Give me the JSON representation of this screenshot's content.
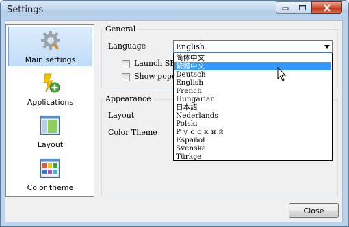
{
  "window": {
    "title": "Settings"
  },
  "sidebar": {
    "items": [
      {
        "label": "Main settings",
        "icon": "gear-icon",
        "selected": true
      },
      {
        "label": "Applications",
        "icon": "app-lightning-icon",
        "selected": false
      },
      {
        "label": "Layout",
        "icon": "layout-icon",
        "selected": false
      },
      {
        "label": "Color theme",
        "icon": "color-theme-icon",
        "selected": false
      }
    ]
  },
  "general": {
    "title": "General",
    "language_label": "Language",
    "language_value": "English",
    "launch_label": "Launch SE-",
    "show_popup_label": "Show popup"
  },
  "appearance": {
    "title": "Appearance",
    "layout_label": "Layout",
    "color_theme_label": "Color Theme"
  },
  "language_options": [
    "简体中文",
    "繁體中文",
    "Deutsch",
    "English",
    "French",
    "Hungarian",
    "日本語",
    "Nederlands",
    "Polski",
    "Русский",
    "Español",
    "Svenska",
    "Türkçe"
  ],
  "highlighted_option_index": 1,
  "footer": {
    "close_label": "Close"
  },
  "colors": {
    "selection": "#3399ff",
    "accent_border": "#3c7fb1",
    "sidebar_selected": "#c1dcf8"
  }
}
